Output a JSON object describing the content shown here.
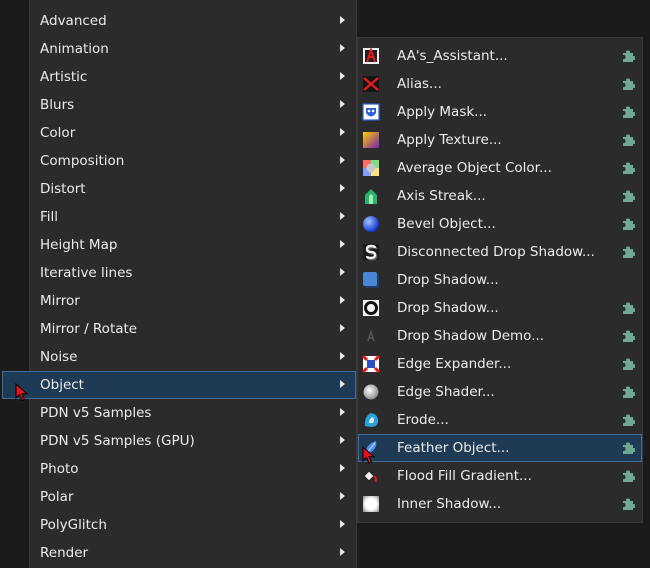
{
  "left_menu": {
    "items": [
      {
        "label": "Advanced"
      },
      {
        "label": "Animation"
      },
      {
        "label": "Artistic"
      },
      {
        "label": "Blurs"
      },
      {
        "label": "Color"
      },
      {
        "label": "Composition"
      },
      {
        "label": "Distort"
      },
      {
        "label": "Fill"
      },
      {
        "label": "Height Map"
      },
      {
        "label": "Iterative lines"
      },
      {
        "label": "Mirror"
      },
      {
        "label": "Mirror / Rotate"
      },
      {
        "label": "Noise"
      },
      {
        "label": "Object",
        "selected": true
      },
      {
        "label": "PDN v5 Samples"
      },
      {
        "label": "PDN v5 Samples (GPU)"
      },
      {
        "label": "Photo"
      },
      {
        "label": "Polar"
      },
      {
        "label": "PolyGlitch"
      },
      {
        "label": "Render"
      }
    ]
  },
  "object_submenu": {
    "items": [
      {
        "label": "AA's_Assistant...",
        "icon": "aa-assistant-icon",
        "plugin": true
      },
      {
        "label": "Alias...",
        "icon": "alias-icon",
        "plugin": true
      },
      {
        "label": "Apply Mask...",
        "icon": "apply-mask-icon",
        "plugin": true
      },
      {
        "label": "Apply Texture...",
        "icon": "apply-texture-icon",
        "plugin": true
      },
      {
        "label": "Average Object Color...",
        "icon": "average-color-icon",
        "plugin": true
      },
      {
        "label": "Axis Streak...",
        "icon": "axis-streak-icon",
        "plugin": true
      },
      {
        "label": "Bevel Object...",
        "icon": "bevel-object-icon",
        "plugin": true
      },
      {
        "label": "Disconnected Drop Shadow...",
        "icon": "disconnected-shadow-icon",
        "plugin": true
      },
      {
        "label": "Drop Shadow...",
        "icon": "drop-shadow-icon",
        "plugin": false
      },
      {
        "label": "Drop Shadow...",
        "icon": "drop-shadow-ring-icon",
        "plugin": true
      },
      {
        "label": "Drop Shadow Demo...",
        "icon": "drop-shadow-demo-icon",
        "plugin": true
      },
      {
        "label": "Edge Expander...",
        "icon": "edge-expander-icon",
        "plugin": true
      },
      {
        "label": "Edge Shader...",
        "icon": "edge-shader-icon",
        "plugin": true
      },
      {
        "label": "Erode...",
        "icon": "erode-icon",
        "plugin": true
      },
      {
        "label": "Feather Object...",
        "icon": "feather-object-icon",
        "plugin": true,
        "selected": true
      },
      {
        "label": "Flood Fill Gradient...",
        "icon": "flood-fill-icon",
        "plugin": true
      },
      {
        "label": "Inner Shadow...",
        "icon": "inner-shadow-icon",
        "plugin": true
      }
    ]
  },
  "colors": {
    "menu_bg": "#2b2b2b",
    "highlight_bg": "#1e3a55",
    "highlight_border": "#3f6f98",
    "plugin_icon": "#6fa892",
    "cursor": "#e8101a"
  }
}
